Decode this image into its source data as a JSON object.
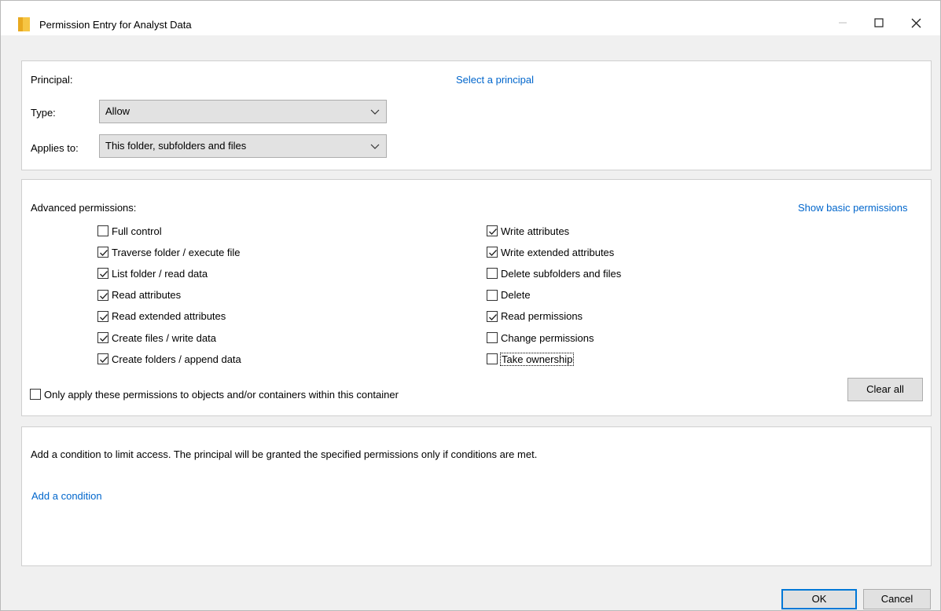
{
  "window": {
    "title": "Permission Entry for Analyst Data",
    "folder_icon": "folder-icon",
    "accent": "#0078d7"
  },
  "principal_section": {
    "principal_label": "Principal:",
    "select_principal_link": "Select a principal",
    "type_label": "Type:",
    "type_value": "Allow",
    "applies_to_label": "Applies to:",
    "applies_to_value": "This folder, subfolders and files"
  },
  "permissions_section": {
    "heading": "Advanced permissions:",
    "show_basic_link": "Show basic permissions",
    "left": [
      {
        "label": "Full control",
        "checked": false
      },
      {
        "label": "Traverse folder / execute file",
        "checked": true
      },
      {
        "label": "List folder / read data",
        "checked": true
      },
      {
        "label": "Read attributes",
        "checked": true
      },
      {
        "label": "Read extended attributes",
        "checked": true
      },
      {
        "label": "Create files / write data",
        "checked": true
      },
      {
        "label": "Create folders / append data",
        "checked": true
      }
    ],
    "right": [
      {
        "label": "Write attributes",
        "checked": true
      },
      {
        "label": "Write extended attributes",
        "checked": true
      },
      {
        "label": "Delete subfolders and files",
        "checked": false
      },
      {
        "label": "Delete",
        "checked": false
      },
      {
        "label": "Read permissions",
        "checked": true
      },
      {
        "label": "Change permissions",
        "checked": false
      },
      {
        "label": "Take ownership",
        "checked": false
      }
    ],
    "only_apply_label": "Only apply these permissions to objects and/or containers within this container",
    "only_apply_checked": false,
    "clear_all_label": "Clear all"
  },
  "condition_section": {
    "description": "Add a condition to limit access. The principal will be granted the specified permissions only if conditions are met.",
    "add_condition_link": "Add a condition"
  },
  "footer": {
    "ok_label": "OK",
    "cancel_label": "Cancel"
  }
}
